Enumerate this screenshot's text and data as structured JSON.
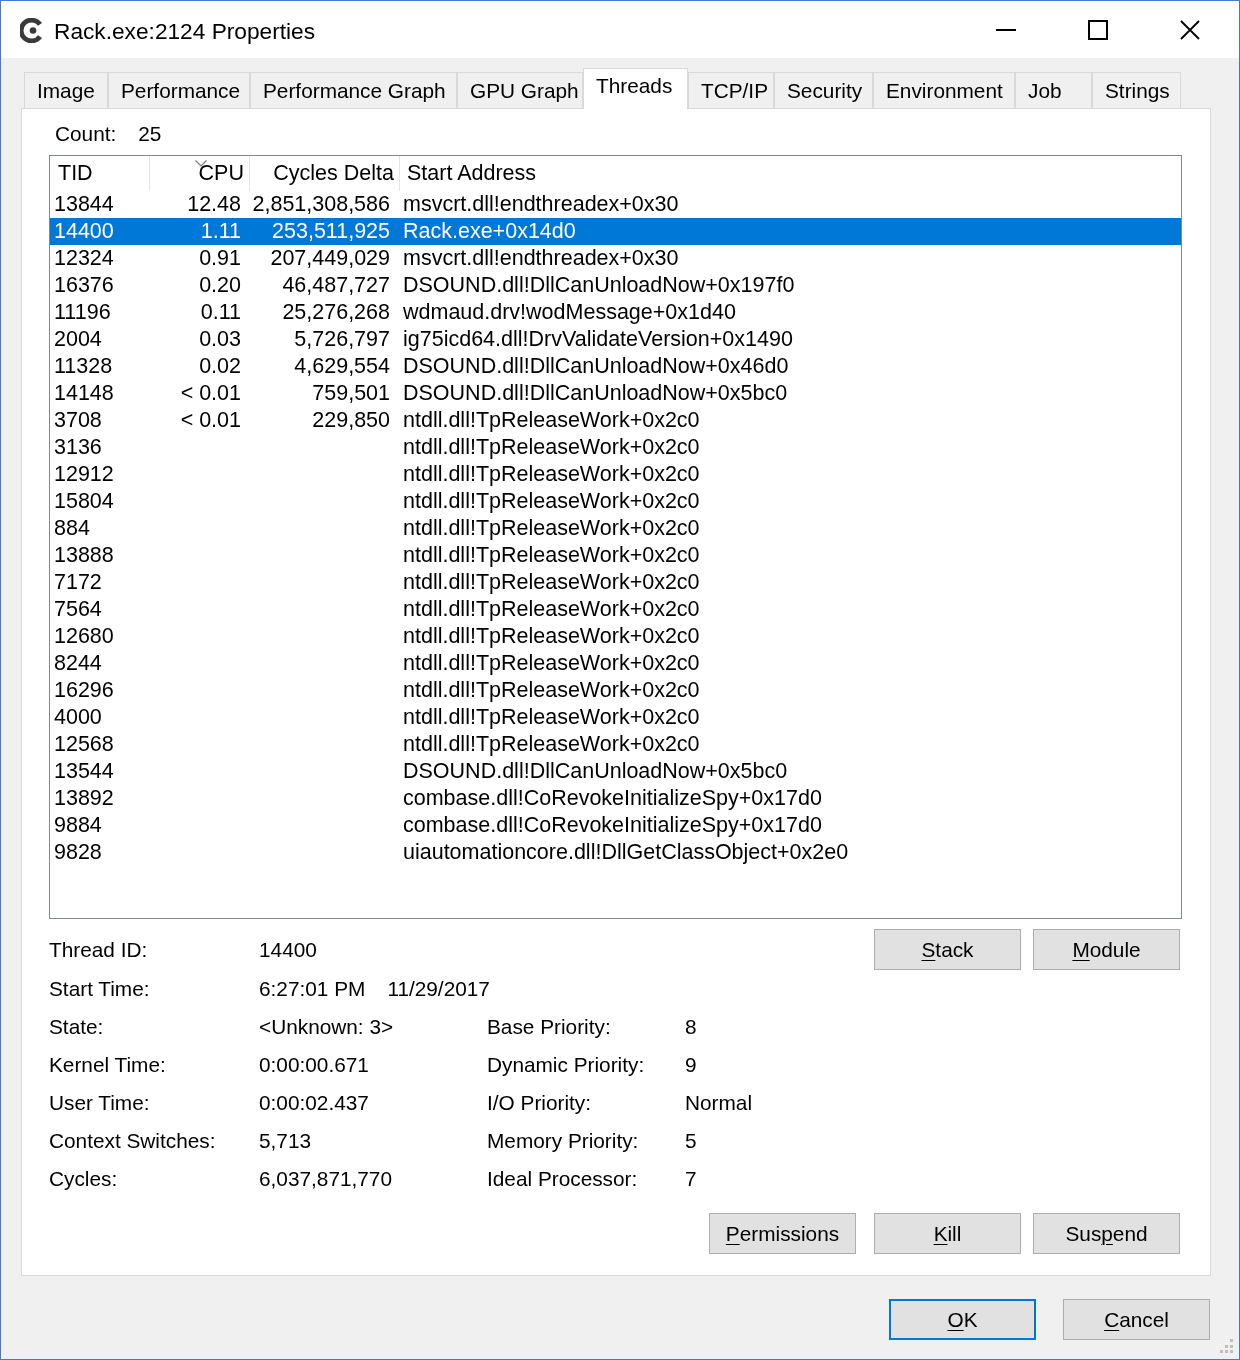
{
  "window": {
    "title": "Rack.exe:2124 Properties"
  },
  "tabs": [
    {
      "label": "Image",
      "selected": false
    },
    {
      "label": "Performance",
      "selected": false
    },
    {
      "label": "Performance Graph",
      "selected": false
    },
    {
      "label": "GPU Graph",
      "selected": false
    },
    {
      "label": "Threads",
      "selected": true
    },
    {
      "label": "TCP/IP",
      "selected": false
    },
    {
      "label": "Security",
      "selected": false
    },
    {
      "label": "Environment",
      "selected": false
    },
    {
      "label": "Job",
      "selected": false
    },
    {
      "label": "Strings",
      "selected": false
    }
  ],
  "count": {
    "label": "Count:",
    "value": "25"
  },
  "table": {
    "columns": [
      {
        "label": "TID",
        "sorted": false
      },
      {
        "label": "CPU",
        "sorted": true
      },
      {
        "label": "Cycles Delta",
        "sorted": false
      },
      {
        "label": "Start Address",
        "sorted": false
      }
    ],
    "rows": [
      {
        "tid": "13844",
        "cpu": "12.48",
        "cycles_delta": "2,851,308,586",
        "start_address": "msvcrt.dll!endthreadex+0x30",
        "selected": false
      },
      {
        "tid": "14400",
        "cpu": "1.11",
        "cycles_delta": "253,511,925",
        "start_address": "Rack.exe+0x14d0",
        "selected": true
      },
      {
        "tid": "12324",
        "cpu": "0.91",
        "cycles_delta": "207,449,029",
        "start_address": "msvcrt.dll!endthreadex+0x30",
        "selected": false
      },
      {
        "tid": "16376",
        "cpu": "0.20",
        "cycles_delta": "46,487,727",
        "start_address": "DSOUND.dll!DllCanUnloadNow+0x197f0",
        "selected": false
      },
      {
        "tid": "11196",
        "cpu": "0.11",
        "cycles_delta": "25,276,268",
        "start_address": "wdmaud.drv!wodMessage+0x1d40",
        "selected": false
      },
      {
        "tid": "2004",
        "cpu": "0.03",
        "cycles_delta": "5,726,797",
        "start_address": "ig75icd64.dll!DrvValidateVersion+0x1490",
        "selected": false
      },
      {
        "tid": "11328",
        "cpu": "0.02",
        "cycles_delta": "4,629,554",
        "start_address": "DSOUND.dll!DllCanUnloadNow+0x46d0",
        "selected": false
      },
      {
        "tid": "14148",
        "cpu": "< 0.01",
        "cycles_delta": "759,501",
        "start_address": "DSOUND.dll!DllCanUnloadNow+0x5bc0",
        "selected": false
      },
      {
        "tid": "3708",
        "cpu": "< 0.01",
        "cycles_delta": "229,850",
        "start_address": "ntdll.dll!TpReleaseWork+0x2c0",
        "selected": false
      },
      {
        "tid": "3136",
        "start_address": "ntdll.dll!TpReleaseWork+0x2c0",
        "selected": false
      },
      {
        "tid": "12912",
        "start_address": "ntdll.dll!TpReleaseWork+0x2c0",
        "selected": false
      },
      {
        "tid": "15804",
        "start_address": "ntdll.dll!TpReleaseWork+0x2c0",
        "selected": false
      },
      {
        "tid": "884",
        "start_address": "ntdll.dll!TpReleaseWork+0x2c0",
        "selected": false
      },
      {
        "tid": "13888",
        "start_address": "ntdll.dll!TpReleaseWork+0x2c0",
        "selected": false
      },
      {
        "tid": "7172",
        "start_address": "ntdll.dll!TpReleaseWork+0x2c0",
        "selected": false
      },
      {
        "tid": "7564",
        "start_address": "ntdll.dll!TpReleaseWork+0x2c0",
        "selected": false
      },
      {
        "tid": "12680",
        "start_address": "ntdll.dll!TpReleaseWork+0x2c0",
        "selected": false
      },
      {
        "tid": "8244",
        "start_address": "ntdll.dll!TpReleaseWork+0x2c0",
        "selected": false
      },
      {
        "tid": "16296",
        "start_address": "ntdll.dll!TpReleaseWork+0x2c0",
        "selected": false
      },
      {
        "tid": "4000",
        "start_address": "ntdll.dll!TpReleaseWork+0x2c0",
        "selected": false
      },
      {
        "tid": "12568",
        "start_address": "ntdll.dll!TpReleaseWork+0x2c0",
        "selected": false
      },
      {
        "tid": "13544",
        "start_address": "DSOUND.dll!DllCanUnloadNow+0x5bc0",
        "selected": false
      },
      {
        "tid": "13892",
        "start_address": "combase.dll!CoRevokeInitializeSpy+0x17d0",
        "selected": false
      },
      {
        "tid": "9884",
        "start_address": "combase.dll!CoRevokeInitializeSpy+0x17d0",
        "selected": false
      },
      {
        "tid": "9828",
        "start_address": "uiautomationcore.dll!DllGetClassObject+0x2e0",
        "selected": false
      }
    ]
  },
  "details": [
    {
      "left": {
        "label": "Thread ID:",
        "value": "14400"
      }
    },
    {
      "left": {
        "label": "Start Time:",
        "value": "6:27:01 PM",
        "date": "11/29/2017"
      }
    },
    {
      "left": {
        "label": "State:",
        "value": "<Unknown: 3>"
      },
      "right": {
        "label": "Base Priority:",
        "value": "8"
      }
    },
    {
      "left": {
        "label": "Kernel Time:",
        "value": "0:00:00.671"
      },
      "right": {
        "label": "Dynamic Priority:",
        "value": "9"
      }
    },
    {
      "left": {
        "label": "User Time:",
        "value": "0:00:02.437"
      },
      "right": {
        "label": "I/O Priority:",
        "value": "Normal"
      }
    },
    {
      "left": {
        "label": "Context Switches:",
        "value": "5,713"
      },
      "right": {
        "label": "Memory Priority:",
        "value": "5"
      }
    },
    {
      "left": {
        "label": "Cycles:",
        "value": "6,037,871,770"
      },
      "right": {
        "label": "Ideal Processor:",
        "value": "7"
      }
    }
  ],
  "thread_buttons": [
    {
      "key": "S",
      "after": "tack"
    },
    {
      "key": "M",
      "after": "odule"
    }
  ],
  "action_buttons": [
    {
      "key": "P",
      "after": "ermissions"
    },
    {
      "key": "K",
      "after": "ill"
    },
    {
      "before": "Sus",
      "key": "p",
      "after": "end"
    }
  ],
  "dialog_buttons": [
    {
      "key": "O",
      "after": "K",
      "default": true
    },
    {
      "key": "C",
      "after": "ancel",
      "default": false
    }
  ]
}
